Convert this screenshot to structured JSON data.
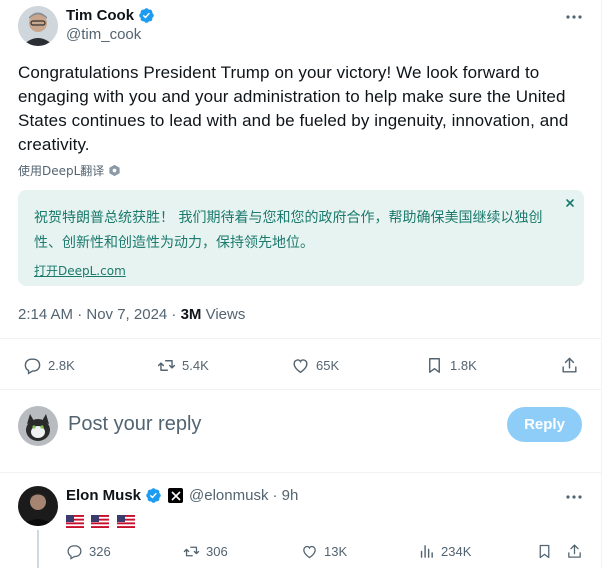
{
  "tweet": {
    "author_name": "Tim Cook",
    "author_handle": "@tim_cook",
    "text": "Congratulations President Trump on your victory!  We look forward to engaging with you and your administration to help make sure the United States continues to lead with and be fueled by ingenuity, innovation, and creativity.",
    "translate_label": "使用DeepL翻译",
    "translation": {
      "text": "祝贺特朗普总统获胜！  我们期待着与您和您的政府合作，帮助确保美国继续以独创性、创新性和创造性为动力，保持领先地位。",
      "open_link": "打开DeepL.com",
      "close_icon": "close-icon"
    },
    "timestamp": "2:14 AM · Nov 7, 2024 · ",
    "views_count": "3M",
    "views_label": " Views",
    "actions": {
      "replies": "2.8K",
      "reposts": "5.4K",
      "likes": "65K",
      "bookmarks": "1.8K"
    }
  },
  "composer": {
    "placeholder": "Post your reply",
    "reply_button": "Reply"
  },
  "reply": {
    "author_name": "Elon Musk",
    "author_handle": "@elonmusk",
    "time": "· 9h",
    "actions": {
      "replies": "326",
      "reposts": "306",
      "likes": "13K",
      "views": "234K"
    }
  },
  "colors": {
    "verified": "#1d9bf0",
    "text": "#0f1419",
    "secondary": "#536471",
    "translation_bg": "#e7f3f1",
    "translation_text": "#1b7a6d",
    "reply_button": "#8ecdf8"
  }
}
